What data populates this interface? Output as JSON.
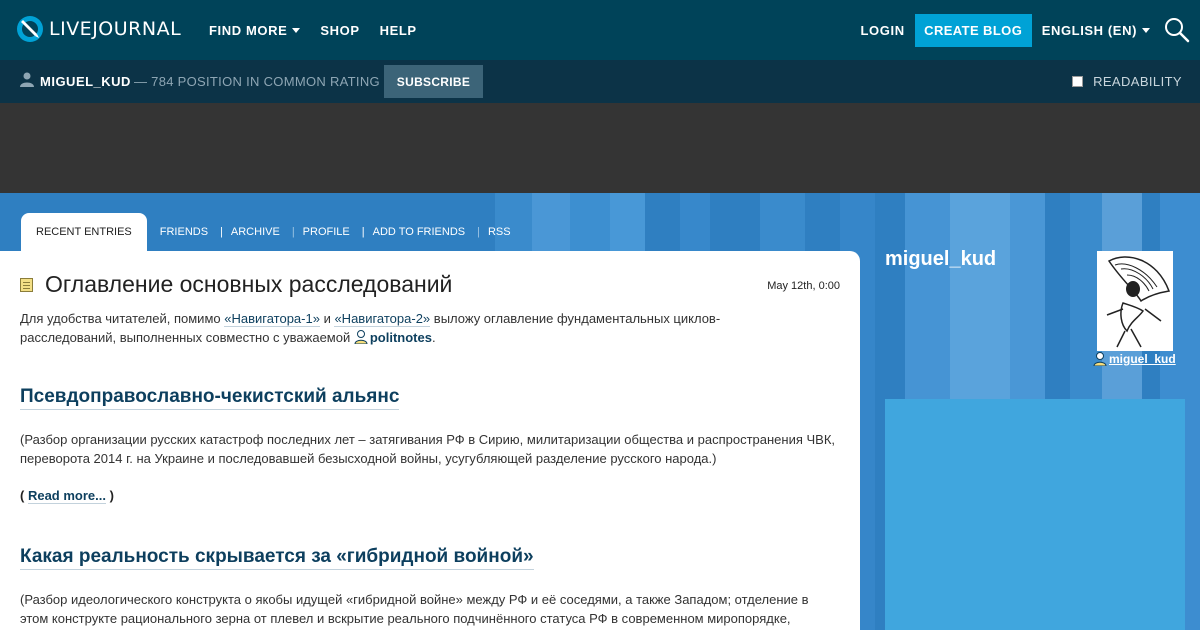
{
  "header": {
    "logo_text": "LIVEJOURNAL",
    "nav": [
      {
        "label": "FIND MORE",
        "dropdown": true
      },
      {
        "label": "SHOP",
        "dropdown": false
      },
      {
        "label": "HELP",
        "dropdown": false
      }
    ],
    "login_label": "LOGIN",
    "create_blog_label": "CREATE BLOG",
    "language_label": "ENGLISH (EN)"
  },
  "userbar": {
    "username": "MIGUEL_KUD",
    "rating_text": "— 784 POSITION IN COMMON RATING",
    "subscribe_label": "SUBSCRIBE",
    "readability_label": "READABILITY"
  },
  "tabs": [
    {
      "label": "RECENT ENTRIES",
      "active": true
    },
    {
      "label": "FRIENDS",
      "active": false
    },
    {
      "label": "ARCHIVE",
      "active": false
    },
    {
      "label": "PROFILE",
      "active": false
    },
    {
      "label": "ADD TO FRIENDS",
      "active": false
    },
    {
      "label": "RSS",
      "active": false
    }
  ],
  "post": {
    "title": "Оглавление основных расследований",
    "date": "May 12th, 0:00",
    "intro_before": "Для удобства читателей, помимо ",
    "link_1": "«Навигатора-1»",
    "intro_and": " и ",
    "link_2": "«Навигатора-2»",
    "intro_after_line1": " выложу оглавление фундаментальных циклов-",
    "intro_line2": "расследований, выполненных совместно с уважаемой ",
    "mention_user": "politnotes",
    "intro_end": "."
  },
  "sections": [
    {
      "title": "Псевдоправославно-чекистский альянс",
      "text": "(Разбор организации русских катастроф последних лет – затягивания РФ в Сирию, милитаризации общества и распространения ЧВК, переворота 2014 г. на Украине и последовавшей безысходной войны, усугубляющей разделение русского народа.)",
      "readmore_open": "( ",
      "readmore_label": "Read more...",
      "readmore_close": " )"
    },
    {
      "title": "Какая реальность скрывается за «гибридной войной»",
      "text": "(Разбор идеологического конструкта о якобы идущей «гибридной войне» между РФ и её соседями, а также Западом; отделение в этом конструкте рационального зерна от плевел и вскрытие реального подчинённого статуса РФ в современном миропорядке,"
    }
  ],
  "sidebar": {
    "name": "miguel_kud",
    "user_link": "miguel_kud"
  },
  "colors": {
    "header_bg": "#004359",
    "userbar_bg": "#0c3347",
    "accent": "#00a2d6",
    "banner_bg": "#343434",
    "page_bg": "#2f7fc1",
    "link": "#0d3f5e"
  }
}
